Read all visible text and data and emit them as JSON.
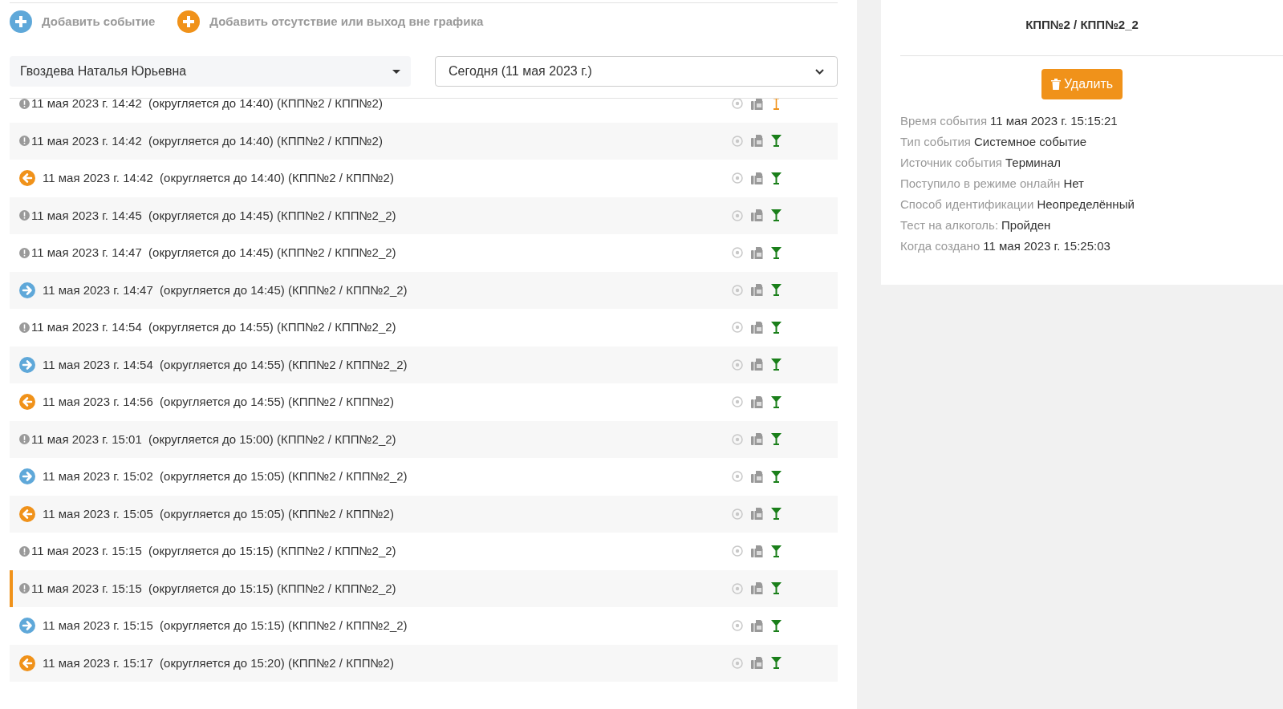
{
  "actions": [
    {
      "kind": "event",
      "label": "Добавить событие"
    },
    {
      "kind": "absence",
      "label": "Добавить отсутствие или выход вне графика"
    }
  ],
  "employee_select": {
    "value": "Гвоздева Наталья Юрьевна"
  },
  "date_select": {
    "value": "Сегодня (11 мая 2023 г.)"
  },
  "events": [
    {
      "kind": "alert",
      "text": "11 мая 2023 г. 14:42  (округляется до 14:40) (КПП№2 / КПП№2)",
      "alcohol_passed": false,
      "selected": false
    },
    {
      "kind": "alert",
      "text": "11 мая 2023 г. 14:42  (округляется до 14:40) (КПП№2 / КПП№2)",
      "alcohol_passed": true,
      "selected": false
    },
    {
      "kind": "exit",
      "text": "11 мая 2023 г. 14:42  (округляется до 14:40) (КПП№2 / КПП№2)",
      "alcohol_passed": true,
      "selected": false
    },
    {
      "kind": "alert",
      "text": "11 мая 2023 г. 14:45  (округляется до 14:45) (КПП№2 / КПП№2_2)",
      "alcohol_passed": true,
      "selected": false
    },
    {
      "kind": "alert",
      "text": "11 мая 2023 г. 14:47  (округляется до 14:45) (КПП№2 / КПП№2_2)",
      "alcohol_passed": true,
      "selected": false
    },
    {
      "kind": "entry",
      "text": "11 мая 2023 г. 14:47  (округляется до 14:45) (КПП№2 / КПП№2_2)",
      "alcohol_passed": true,
      "selected": false
    },
    {
      "kind": "alert",
      "text": "11 мая 2023 г. 14:54  (округляется до 14:55) (КПП№2 / КПП№2_2)",
      "alcohol_passed": true,
      "selected": false
    },
    {
      "kind": "entry",
      "text": "11 мая 2023 г. 14:54  (округляется до 14:55) (КПП№2 / КПП№2_2)",
      "alcohol_passed": true,
      "selected": false
    },
    {
      "kind": "exit",
      "text": "11 мая 2023 г. 14:56  (округляется до 14:55) (КПП№2 / КПП№2)",
      "alcohol_passed": true,
      "selected": false
    },
    {
      "kind": "alert",
      "text": "11 мая 2023 г. 15:01  (округляется до 15:00) (КПП№2 / КПП№2_2)",
      "alcohol_passed": true,
      "selected": false
    },
    {
      "kind": "entry",
      "text": "11 мая 2023 г. 15:02  (округляется до 15:05) (КПП№2 / КПП№2_2)",
      "alcohol_passed": true,
      "selected": false
    },
    {
      "kind": "exit",
      "text": "11 мая 2023 г. 15:05  (округляется до 15:05) (КПП№2 / КПП№2)",
      "alcohol_passed": true,
      "selected": false
    },
    {
      "kind": "alert",
      "text": "11 мая 2023 г. 15:15  (округляется до 15:15) (КПП№2 / КПП№2_2)",
      "alcohol_passed": true,
      "selected": false
    },
    {
      "kind": "alert",
      "text": "11 мая 2023 г. 15:15  (округляется до 15:15) (КПП№2 / КПП№2_2)",
      "alcohol_passed": true,
      "selected": true
    },
    {
      "kind": "entry",
      "text": "11 мая 2023 г. 15:15  (округляется до 15:15) (КПП№2 / КПП№2_2)",
      "alcohol_passed": true,
      "selected": false
    },
    {
      "kind": "exit",
      "text": "11 мая 2023 г. 15:17  (округляется до 15:20) (КПП№2 / КПП№2)",
      "alcohol_passed": true,
      "selected": false
    }
  ],
  "details": {
    "title": "КПП№2 / КПП№2_2",
    "delete_button": "Удалить",
    "fields": [
      {
        "label": "Время события",
        "value": "11 мая 2023 г. 15:15:21"
      },
      {
        "label": "Тип события",
        "value": "Системное событие"
      },
      {
        "label": "Источник события",
        "value": "Терминал"
      },
      {
        "label": "Поступило в режиме онлайн",
        "value": "Нет"
      },
      {
        "label": "Способ идентификации",
        "value": "Неопределённый"
      },
      {
        "label": "Тест на алкоголь:",
        "value": "Пройден"
      },
      {
        "label": "Когда создано",
        "value": "11 мая 2023 г. 15:25:03"
      }
    ]
  }
}
